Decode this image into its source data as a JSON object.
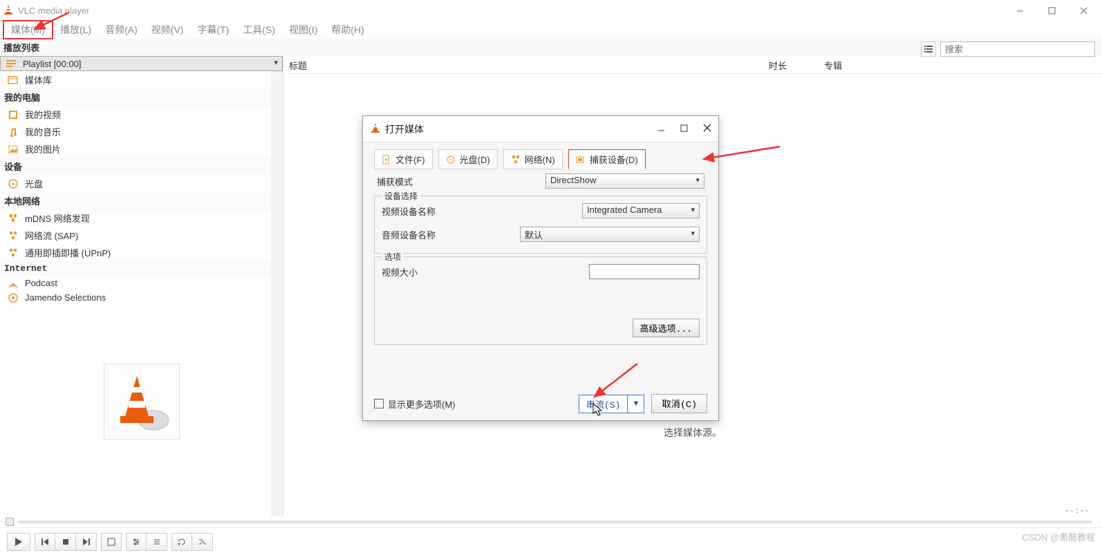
{
  "window": {
    "title": "VLC media player",
    "time_display": "--:--"
  },
  "menubar": [
    "媒体(M)",
    "播放(L)",
    "音频(A)",
    "视频(V)",
    "字幕(T)",
    "工具(S)",
    "视图(I)",
    "帮助(H)"
  ],
  "playlist_header": "播放列表",
  "sidebar": {
    "playlist_row": "Playlist [00:00]",
    "media_lib": "媒体库",
    "cat_mycomputer": "我的电脑",
    "my_videos": "我的视频",
    "my_music": "我的音乐",
    "my_pictures": "我的图片",
    "cat_devices": "设备",
    "disc": "光盘",
    "cat_localnet": "本地网络",
    "mdns": "mDNS 网络发现",
    "sap": "网络流 (SAP)",
    "upnp": "通用即插即播  (UPnP)",
    "cat_internet": "Internet",
    "podcast": "Podcast",
    "jamendo": "Jamendo Selections"
  },
  "search": {
    "placeholder": "搜索"
  },
  "columns": {
    "title": "标题",
    "duration": "时长",
    "album": "专辑"
  },
  "main_hint": "选择媒体源。",
  "dialog": {
    "title": "打开媒体",
    "tabs": {
      "file": "文件(F)",
      "disc": "光盘(D)",
      "network": "网络(N)",
      "capture": "捕获设备(D)"
    },
    "capture_mode_label": "捕获模式",
    "capture_mode_value": "DirectShow",
    "device_select_legend": "设备选择",
    "video_device_label": "视频设备名称",
    "video_device_value": "Integrated Camera",
    "audio_device_label": "音频设备名称",
    "audio_device_value": "默认",
    "options_legend": "选项",
    "video_size_label": "视频大小",
    "advanced_btn": "高级选项...",
    "show_more": "显示更多选项(M)",
    "stream_btn": "串流(S)",
    "cancel_btn": "取消(C)"
  },
  "watermark": "CSDN @奥酷教程"
}
